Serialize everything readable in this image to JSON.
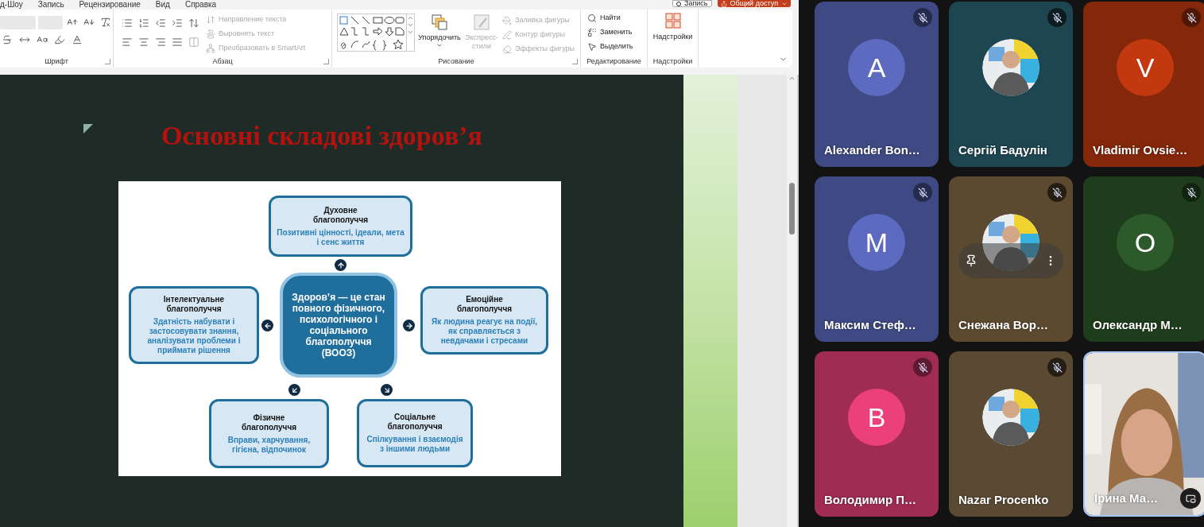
{
  "menu_tabs": [
    "д-Шоу",
    "Запись",
    "Рецензирование",
    "Вид",
    "Справка"
  ],
  "top_buttons": {
    "record": "Запись",
    "share": "Общий доступ"
  },
  "ribbon": {
    "font": {
      "label": "Шрифт"
    },
    "paragraph": {
      "label": "Абзац",
      "commands": [
        {
          "label": "Направление текста",
          "disabled": true
        },
        {
          "label": "Выровнять текст",
          "disabled": true
        },
        {
          "label": "Преобразовать в SmartArt",
          "disabled": true
        }
      ]
    },
    "drawing": {
      "label": "Рисование",
      "arrange": "Упорядочить",
      "quick_styles": {
        "label": "Экспресс-стили",
        "disabled": true
      },
      "commands": [
        {
          "label": "Заливка фигуры",
          "disabled": true
        },
        {
          "label": "Контур фигуры",
          "disabled": true
        },
        {
          "label": "Эффекты фигуры",
          "disabled": true
        }
      ]
    },
    "editing": {
      "label": "Редактирование",
      "commands": [
        {
          "kind": "find",
          "label": "Найти"
        },
        {
          "kind": "replace",
          "label": "Заменить"
        },
        {
          "kind": "select",
          "label": "Выделить"
        }
      ]
    },
    "addins": {
      "label": "Надстройки",
      "button": "Надстройки"
    }
  },
  "slide": {
    "title": "Основні складові здоров’я",
    "diagram": {
      "center": "Здоров’я — це стан повного фізичного, психологічного і соціального благополуччя (ВООЗ)",
      "boxes": [
        {
          "heading": "Духовне благополуччя",
          "text": "Позитивні цінності, ідеали, мета і сенс життя"
        },
        {
          "heading": "Інтелектуальне благополуччя",
          "text": "Здатність набувати і застосовувати знання, аналізувати проблеми і приймати рішення"
        },
        {
          "heading": "Емоційне благополуччя",
          "text": "Як людина реагує на події, як справляється з невдачами і стресами"
        },
        {
          "heading": "Фізичне благополуччя",
          "text": "Вправи, харчування, гігієна, відпочинок"
        },
        {
          "heading": "Соціальне благополуччя",
          "text": "Спілкування і взаємодія з іншими людьми"
        }
      ]
    }
  },
  "participants": [
    {
      "name": "Alexander Bon…",
      "kind": "letter",
      "letter": "A",
      "color": "#5c6bc0",
      "muted": true,
      "hovered": false,
      "highlighted": false
    },
    {
      "name": "Сергій Бадулін",
      "color": "#1e4650",
      "muted": true,
      "hovered": false,
      "highlighted": false
    },
    {
      "name": "Vladimir Ovsie…",
      "kind": "letter",
      "letter": "V",
      "color": "#c2390f",
      "muted": true,
      "hovered": false,
      "highlighted": false
    },
    {
      "name": "Максим Стеф…",
      "kind": "letter",
      "letter": "M",
      "color": "#5c6bc0",
      "muted": true,
      "hovered": false,
      "highlighted": false
    },
    {
      "name": "Снежана Вор…",
      "color": "#5c4a30",
      "muted": true,
      "hovered": true,
      "highlighted": false
    },
    {
      "name": "Олександр М…",
      "kind": "letter",
      "letter": "O",
      "color": "#2c5a2a",
      "muted": true,
      "hovered": false,
      "highlighted": false
    },
    {
      "name": "Володимир П…",
      "kind": "letter",
      "letter": "B",
      "color": "#ec407a",
      "muted": true,
      "hovered": false,
      "highlighted": false
    },
    {
      "name": "Nazar Procenko",
      "color": "#5a4a34",
      "muted": true,
      "hovered": false,
      "highlighted": false
    },
    {
      "name": "Ірина Ма…",
      "kind": "video",
      "muted": false,
      "hovered": false,
      "highlighted": true
    }
  ]
}
